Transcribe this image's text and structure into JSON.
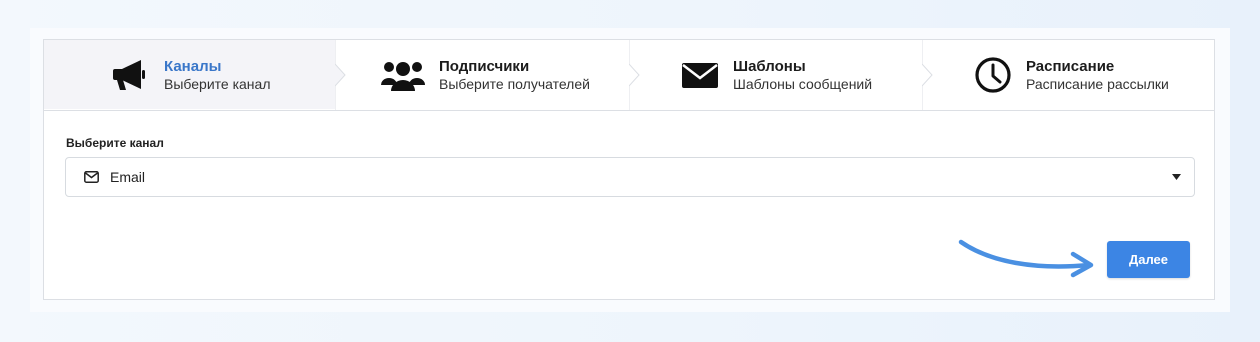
{
  "steps": [
    {
      "title": "Каналы",
      "subtitle": "Выберите канал",
      "icon": "megaphone-icon",
      "active": true
    },
    {
      "title": "Подписчики",
      "subtitle": "Выберите получателей",
      "icon": "users-icon",
      "active": false
    },
    {
      "title": "Шаблоны",
      "subtitle": "Шаблоны сообщений",
      "icon": "envelope-icon",
      "active": false
    },
    {
      "title": "Расписание",
      "subtitle": "Расписание рассылки",
      "icon": "clock-icon",
      "active": false
    }
  ],
  "form": {
    "channel_label": "Выберите канал",
    "channel_value": "Email",
    "channel_icon": "envelope-outline-icon"
  },
  "actions": {
    "next_label": "Далее"
  },
  "colors": {
    "accent": "#3c85e4",
    "active_step_title": "#3a77c9",
    "active_step_bg": "#f4f4f8",
    "annotation_arrow": "#4a90e2"
  }
}
